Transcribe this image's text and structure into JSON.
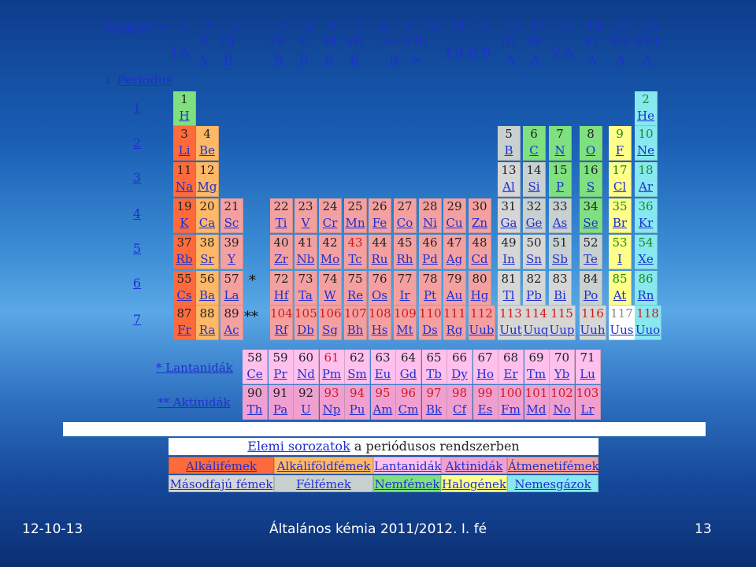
{
  "header": {
    "csoport": "Csoport",
    "arrow": "→",
    "periodus_arrow": "↓",
    "periodus": "Periódus",
    "groups": [
      "1",
      "2",
      "3",
      "4",
      "5",
      "6",
      "7",
      "8",
      "9",
      "10",
      "11",
      "12",
      "13",
      "14",
      "15",
      "16",
      "17",
      "18"
    ],
    "sub": {
      "IA": "I A",
      "IIA1": "II",
      "IIA2": "A",
      "IIIB1": "III",
      "IIIB2": "B",
      "IVB1": "IV",
      "IVB2": "B",
      "VB1": "V",
      "VB2": "B",
      "VIB1": "VI",
      "VIB2": "B",
      "VIIB1": "VII",
      "VIIB2": "B",
      "VIII1": "<-- VIII",
      "VIII2": "B -->",
      "IBIIB": "I B II B",
      "IIIA1": "III",
      "IIIA2": "A",
      "IVA1": "IV",
      "IVA2": "A",
      "VA": "V A",
      "VIA1": "VI",
      "VIA2": "A",
      "VIIA1": "VII",
      "VIIA2": "A",
      "VIIIA1": "VIII",
      "VIIIA2": "A"
    }
  },
  "periods": [
    "1",
    "2",
    "3",
    "4",
    "5",
    "6",
    "7"
  ],
  "elements": [
    [
      "1",
      "H",
      0,
      0,
      "h"
    ],
    [
      "2",
      "He",
      0,
      17,
      "ng"
    ],
    [
      "3",
      "Li",
      1,
      0,
      "alk"
    ],
    [
      "4",
      "Be",
      1,
      1,
      "alf"
    ],
    [
      "5",
      "B",
      1,
      12,
      "met"
    ],
    [
      "6",
      "C",
      1,
      13,
      "nm"
    ],
    [
      "7",
      "N",
      1,
      14,
      "nm"
    ],
    [
      "8",
      "O",
      1,
      15,
      "nm"
    ],
    [
      "9",
      "F",
      1,
      16,
      "hal"
    ],
    [
      "10",
      "Ne",
      1,
      17,
      "ng"
    ],
    [
      "11",
      "Na",
      2,
      0,
      "alk"
    ],
    [
      "12",
      "Mg",
      2,
      1,
      "alf"
    ],
    [
      "13",
      "Al",
      2,
      12,
      "pm"
    ],
    [
      "14",
      "Si",
      2,
      13,
      "met"
    ],
    [
      "15",
      "P",
      2,
      14,
      "nm"
    ],
    [
      "16",
      "S",
      2,
      15,
      "nm"
    ],
    [
      "17",
      "Cl",
      2,
      16,
      "hal"
    ],
    [
      "18",
      "Ar",
      2,
      17,
      "ng"
    ],
    [
      "19",
      "K",
      3,
      0,
      "alk"
    ],
    [
      "20",
      "Ca",
      3,
      1,
      "alf"
    ],
    [
      "21",
      "Sc",
      3,
      2,
      "tm"
    ],
    [
      "22",
      "Ti",
      3,
      3,
      "tm"
    ],
    [
      "23",
      "V",
      3,
      4,
      "tm"
    ],
    [
      "24",
      "Cr",
      3,
      5,
      "tm"
    ],
    [
      "25",
      "Mn",
      3,
      6,
      "tm"
    ],
    [
      "26",
      "Fe",
      3,
      7,
      "tm"
    ],
    [
      "27",
      "Co",
      3,
      8,
      "tm"
    ],
    [
      "28",
      "Ni",
      3,
      9,
      "tm"
    ],
    [
      "29",
      "Cu",
      3,
      10,
      "tm"
    ],
    [
      "30",
      "Zn",
      3,
      11,
      "tm"
    ],
    [
      "31",
      "Ga",
      3,
      12,
      "pm"
    ],
    [
      "32",
      "Ge",
      3,
      13,
      "met"
    ],
    [
      "33",
      "As",
      3,
      14,
      "met"
    ],
    [
      "34",
      "Se",
      3,
      15,
      "nm"
    ],
    [
      "35",
      "Br",
      3,
      16,
      "hal"
    ],
    [
      "36",
      "Kr",
      3,
      17,
      "ng"
    ],
    [
      "37",
      "Rb",
      4,
      0,
      "alk"
    ],
    [
      "38",
      "Sr",
      4,
      1,
      "alf"
    ],
    [
      "39",
      "Y",
      4,
      2,
      "tm"
    ],
    [
      "40",
      "Zr",
      4,
      3,
      "tm"
    ],
    [
      "41",
      "Nb",
      4,
      4,
      "tm"
    ],
    [
      "42",
      "Mo",
      4,
      5,
      "tm"
    ],
    [
      "43",
      "Tc",
      4,
      6,
      "tm"
    ],
    [
      "44",
      "Ru",
      4,
      7,
      "tm"
    ],
    [
      "45",
      "Rh",
      4,
      8,
      "tm"
    ],
    [
      "46",
      "Pd",
      4,
      9,
      "tm"
    ],
    [
      "47",
      "Ag",
      4,
      10,
      "tm"
    ],
    [
      "48",
      "Cd",
      4,
      11,
      "tm"
    ],
    [
      "49",
      "In",
      4,
      12,
      "pm"
    ],
    [
      "50",
      "Sn",
      4,
      13,
      "pm"
    ],
    [
      "51",
      "Sb",
      4,
      14,
      "met"
    ],
    [
      "52",
      "Te",
      4,
      15,
      "met"
    ],
    [
      "53",
      "I",
      4,
      16,
      "hal"
    ],
    [
      "54",
      "Xe",
      4,
      17,
      "ng"
    ],
    [
      "55",
      "Cs",
      5,
      0,
      "alk"
    ],
    [
      "56",
      "Ba",
      5,
      1,
      "alf"
    ],
    [
      "57",
      "La",
      5,
      2,
      "tm"
    ],
    [
      "72",
      "Hf",
      5,
      3,
      "tm"
    ],
    [
      "73",
      "Ta",
      5,
      4,
      "tm"
    ],
    [
      "74",
      "W",
      5,
      5,
      "tm"
    ],
    [
      "75",
      "Re",
      5,
      6,
      "tm"
    ],
    [
      "76",
      "Os",
      5,
      7,
      "tm"
    ],
    [
      "77",
      "Ir",
      5,
      8,
      "tm"
    ],
    [
      "78",
      "Pt",
      5,
      9,
      "tm"
    ],
    [
      "79",
      "Au",
      5,
      10,
      "tm"
    ],
    [
      "80",
      "Hg",
      5,
      11,
      "tm"
    ],
    [
      "81",
      "Tl",
      5,
      12,
      "pm"
    ],
    [
      "82",
      "Pb",
      5,
      13,
      "pm"
    ],
    [
      "83",
      "Bi",
      5,
      14,
      "pm"
    ],
    [
      "84",
      "Po",
      5,
      15,
      "met"
    ],
    [
      "85",
      "At",
      5,
      16,
      "hal"
    ],
    [
      "86",
      "Rn",
      5,
      17,
      "ng"
    ],
    [
      "87",
      "Fr",
      6,
      0,
      "alk"
    ],
    [
      "88",
      "Ra",
      6,
      1,
      "alf"
    ],
    [
      "89",
      "Ac",
      6,
      2,
      "tm"
    ],
    [
      "104",
      "Rf",
      6,
      3,
      "tm"
    ],
    [
      "105",
      "Db",
      6,
      4,
      "tm"
    ],
    [
      "106",
      "Sg",
      6,
      5,
      "tm"
    ],
    [
      "107",
      "Bh",
      6,
      6,
      "tm"
    ],
    [
      "108",
      "Hs",
      6,
      7,
      "tm"
    ],
    [
      "109",
      "Mt",
      6,
      8,
      "tm"
    ],
    [
      "110",
      "Ds",
      6,
      9,
      "tm"
    ],
    [
      "111",
      "Rg",
      6,
      10,
      "tm"
    ],
    [
      "112",
      "Uub",
      6,
      11,
      "tm"
    ],
    [
      "113",
      "Uut",
      6,
      12,
      "pm"
    ],
    [
      "114",
      "Uuq",
      6,
      13,
      "pm"
    ],
    [
      "115",
      "Uup",
      6,
      14,
      "pm"
    ],
    [
      "116",
      "Uuh",
      6,
      15,
      "pm"
    ],
    [
      "117",
      "Uus",
      6,
      16,
      "unk"
    ],
    [
      "118",
      "Uuo",
      6,
      17,
      "ng"
    ]
  ],
  "redz": [
    "43",
    "61",
    "93",
    "94",
    "95",
    "96",
    "97",
    "98",
    "99",
    "100",
    "101",
    "102",
    "103",
    "104",
    "105",
    "106",
    "107",
    "108",
    "109",
    "110",
    "111",
    "112",
    "113",
    "114",
    "115",
    "116",
    "118"
  ],
  "grayz": [
    "117"
  ],
  "greenz": [
    "2",
    "9",
    "10",
    "17",
    "18",
    "35",
    "36",
    "53",
    "54",
    "85",
    "86"
  ],
  "blackz_in_grn": [],
  "markers": {
    "single": "*",
    "double": "**"
  },
  "lanthanides_label": "* Lantanidák",
  "actinides_label": "** Aktinidák",
  "lanthanides": [
    [
      "58",
      "Ce"
    ],
    [
      "59",
      "Pr"
    ],
    [
      "60",
      "Nd"
    ],
    [
      "61",
      "Pm"
    ],
    [
      "62",
      "Sm"
    ],
    [
      "63",
      "Eu"
    ],
    [
      "64",
      "Gd"
    ],
    [
      "65",
      "Tb"
    ],
    [
      "66",
      "Dy"
    ],
    [
      "67",
      "Ho"
    ],
    [
      "68",
      "Er"
    ],
    [
      "69",
      "Tm"
    ],
    [
      "70",
      "Yb"
    ],
    [
      "71",
      "Lu"
    ]
  ],
  "actinides": [
    [
      "90",
      "Th"
    ],
    [
      "91",
      "Pa"
    ],
    [
      "92",
      "U"
    ],
    [
      "93",
      "Np"
    ],
    [
      "94",
      "Pu"
    ],
    [
      "95",
      "Am"
    ],
    [
      "96",
      "Cm"
    ],
    [
      "97",
      "Bk"
    ],
    [
      "98",
      "Cf"
    ],
    [
      "99",
      "Es"
    ],
    [
      "100",
      "Fm"
    ],
    [
      "101",
      "Md"
    ],
    [
      "102",
      "No"
    ],
    [
      "103",
      "Lr"
    ]
  ],
  "legend": {
    "title_link": "Elemi sorozatok",
    "title_rest": " a periódusos rendszerben",
    "row1": [
      "Alkálifémek",
      "Alkáliföldfémek",
      "Lantanidák",
      "Aktinidák",
      "Átmenetifémek"
    ],
    "row2": [
      "Másodfajú fémek",
      "Félfémek",
      "Nemfémek",
      "Halogének",
      "Nemesgázok"
    ]
  },
  "colors": {
    "alk": "#ff6a3d",
    "alf": "#ffb866",
    "la": "#ffc0ee",
    "ac": "#f0a0d0",
    "tm": "#f5a0a0",
    "pm": "#d6d6d6",
    "met": "#c9d0d0",
    "nm": "#7fe07f",
    "hal": "#ffff8a",
    "ng": "#87e8f0"
  },
  "footer": {
    "date": "12-10-13",
    "course": "Általános kémia 2011/2012. I. fé",
    "page": "13"
  }
}
